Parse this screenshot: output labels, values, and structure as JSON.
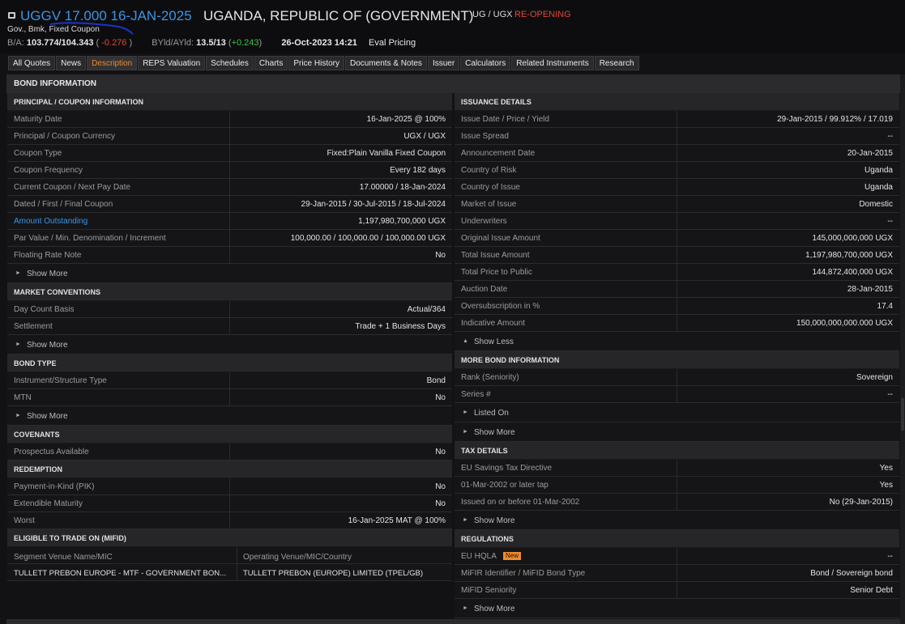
{
  "header": {
    "ticker": "UGGV 17.000 16-JAN-2025",
    "issuer": "UGANDA, REPUBLIC OF (GOVERNMENT)",
    "currency": "UG / UGX",
    "status": "RE-OPENING",
    "subtitle": "Gov., Bmk, Fixed Coupon",
    "ba_label": "B/A:",
    "ba_value": "103.774/104.343",
    "ba_change": "-0.276",
    "byld_label": "BYld/AYld:",
    "byld_value": "13.5/13",
    "byld_change": "+0.243",
    "datetime": "26-Oct-2023 14:21",
    "pricing": "Eval Pricing"
  },
  "tabs": [
    "All Quotes",
    "News",
    "Description",
    "REPS Valuation",
    "Schedules",
    "Charts",
    "Price History",
    "Documents & Notes",
    "Issuer",
    "Calculators",
    "Related Instruments",
    "Research"
  ],
  "active_tab": "Description",
  "bond_information_title": "BOND INFORMATION",
  "left": {
    "principal": {
      "title": "PRINCIPAL / COUPON INFORMATION",
      "rows": [
        {
          "label": "Maturity Date",
          "value": "16-Jan-2025 @ 100%"
        },
        {
          "label": "Principal / Coupon Currency",
          "value": "UGX / UGX"
        },
        {
          "label": "Coupon Type",
          "value": "Fixed:Plain Vanilla Fixed Coupon"
        },
        {
          "label": "Coupon Frequency",
          "value": "Every 182 days"
        },
        {
          "label": "Current Coupon / Next Pay Date",
          "value": "17.00000 / 18-Jan-2024"
        },
        {
          "label": "Dated / First / Final Coupon",
          "value": "29-Jan-2015 / 30-Jul-2015 / 18-Jul-2024"
        },
        {
          "label": "Amount Outstanding",
          "value": "1,197,980,700,000 UGX"
        },
        {
          "label": "Par Value / Min. Denomination / Increment",
          "value": "100,000.00 / 100,000.00 / 100,000.00 UGX"
        },
        {
          "label": "Floating Rate Note",
          "value": "No"
        }
      ],
      "more": "Show More"
    },
    "market": {
      "title": "MARKET CONVENTIONS",
      "rows": [
        {
          "label": "Day Count Basis",
          "value": "Actual/364"
        },
        {
          "label": "Settlement",
          "value": "Trade + 1 Business Days"
        }
      ],
      "more": "Show More"
    },
    "bondtype": {
      "title": "BOND TYPE",
      "rows": [
        {
          "label": "Instrument/Structure Type",
          "value": "Bond"
        },
        {
          "label": "MTN",
          "value": "No"
        }
      ],
      "more": "Show More"
    },
    "covenants": {
      "title": "COVENANTS",
      "rows": [
        {
          "label": "Prospectus Available",
          "value": "No"
        }
      ]
    },
    "redemption": {
      "title": "REDEMPTION",
      "rows": [
        {
          "label": "Payment-in-Kind (PIK)",
          "value": "No"
        },
        {
          "label": "Extendible Maturity",
          "value": "No"
        },
        {
          "label": "Worst",
          "value": "16-Jan-2025 MAT @ 100%"
        }
      ]
    },
    "mifid": {
      "title": "ELIGIBLE TO TRADE ON (MIFID)",
      "col1_header": "Segment Venue Name/MIC",
      "col2_header": "Operating Venue/MIC/Country",
      "col1_value": "TULLETT PREBON EUROPE - MTF - GOVERNMENT BON...",
      "col2_value": "TULLETT PREBON (EUROPE) LIMITED (TPEL/GB)"
    }
  },
  "right": {
    "issuance": {
      "title": "ISSUANCE DETAILS",
      "rows": [
        {
          "label": "Issue Date / Price / Yield",
          "value": "29-Jan-2015 / 99.912% / 17.019"
        },
        {
          "label": "Issue Spread",
          "value": "--"
        },
        {
          "label": "Announcement Date",
          "value": "20-Jan-2015"
        },
        {
          "label": "Country of Risk",
          "value": "Uganda"
        },
        {
          "label": "Country of Issue",
          "value": "Uganda"
        },
        {
          "label": "Market of Issue",
          "value": "Domestic"
        },
        {
          "label": "Underwriters",
          "value": "--"
        },
        {
          "label": "Original Issue Amount",
          "value": "145,000,000,000 UGX"
        },
        {
          "label": "Total Issue Amount",
          "value": "1,197,980,700,000 UGX"
        },
        {
          "label": "Total Price to Public",
          "value": "144,872,400,000 UGX"
        },
        {
          "label": "Auction Date",
          "value": "28-Jan-2015"
        },
        {
          "label": "Oversubscription in %",
          "value": "17.4"
        },
        {
          "label": "Indicative Amount",
          "value": "150,000,000,000.000 UGX"
        }
      ],
      "less": "Show Less"
    },
    "morebond": {
      "title": "MORE BOND INFORMATION",
      "rows": [
        {
          "label": "Rank (Seniority)",
          "value": "Sovereign"
        },
        {
          "label": "Series #",
          "value": "--"
        }
      ],
      "listed": "Listed On",
      "more": "Show More"
    },
    "tax": {
      "title": "TAX DETAILS",
      "rows": [
        {
          "label": "EU Savings Tax Directive",
          "value": "Yes"
        },
        {
          "label": "01-Mar-2002 or later tap",
          "value": "Yes"
        },
        {
          "label": "Issued on or before 01-Mar-2002",
          "value": "No (29-Jan-2015)"
        }
      ],
      "more": "Show More"
    },
    "regulations": {
      "title": "REGULATIONS",
      "rows": [
        {
          "label": "EU HQLA",
          "value": "--",
          "badge": "New"
        },
        {
          "label": "MiFIR Identifier / MiFID Bond Type",
          "value": "Bond / Sovereign bond"
        },
        {
          "label": "MiFID Seniority",
          "value": "Senior Debt"
        }
      ],
      "more": "Show More"
    }
  },
  "colors": {
    "accent": "#3a95e6",
    "active_tab": "#f08a2a",
    "negative": "#e0463a",
    "positive": "#39c43f"
  }
}
